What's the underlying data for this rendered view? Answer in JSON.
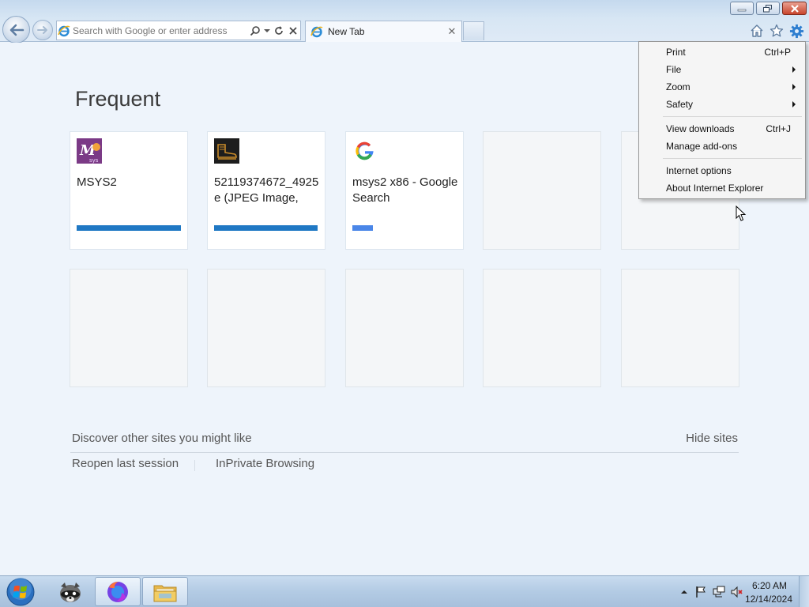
{
  "window": {
    "minimize_icon": "minimize-icon",
    "restore_icon": "restore-icon",
    "close_icon": "close-icon"
  },
  "navigation": {
    "back_icon": "back-arrow-icon",
    "forward_icon": "forward-arrow-icon"
  },
  "address_bar": {
    "placeholder": "Search with Google or enter address",
    "icons": [
      "ie-logo-icon",
      "search-icon",
      "dropdown-arrow-icon",
      "refresh-icon",
      "stop-icon"
    ]
  },
  "tabs": [
    {
      "label": "New Tab",
      "icon": "ie-logo-icon",
      "active": true
    }
  ],
  "toolbar": {
    "icons": [
      "home-icon",
      "favorites-star-icon",
      "tools-gear-icon"
    ]
  },
  "new_tab_page": {
    "title": "Frequent",
    "tiles": [
      {
        "title": "MSYS2",
        "icon": "msys2-logo-icon",
        "bar_fraction": 1.0
      },
      {
        "title": "52119374672_4925e (JPEG Image,",
        "icon": "boot-image-icon",
        "bar_fraction": 1.0
      },
      {
        "title": "msys2 x86 - Google Search",
        "icon": "google-g-icon",
        "bar_fraction": 0.2
      }
    ],
    "discover_text": "Discover other sites you might like",
    "hide_sites_label": "Hide sites",
    "reopen_label": "Reopen last session",
    "inprivate_label": "InPrivate Browsing"
  },
  "tools_menu": {
    "items": [
      {
        "label": "Print",
        "shortcut": "Ctrl+P",
        "submenu": false
      },
      {
        "label": "File",
        "shortcut": "",
        "submenu": true
      },
      {
        "label": "Zoom",
        "shortcut": "",
        "submenu": true
      },
      {
        "label": "Safety",
        "shortcut": "",
        "submenu": true
      },
      {
        "label": "View downloads",
        "shortcut": "Ctrl+J",
        "submenu": false
      },
      {
        "label": "Manage add-ons",
        "shortcut": "",
        "submenu": false
      },
      {
        "label": "Internet options",
        "shortcut": "",
        "submenu": false
      },
      {
        "label": "About Internet Explorer",
        "shortcut": "",
        "submenu": false
      }
    ]
  },
  "taskbar": {
    "start_icon": "windows-start-icon",
    "apps": [
      {
        "name": "raccoon-app-icon",
        "active": false
      },
      {
        "name": "firefox-icon",
        "active": true
      },
      {
        "name": "file-explorer-icon",
        "active": true
      }
    ],
    "tray_icons": [
      "show-hidden-icons-arrow",
      "action-center-flag-icon",
      "network-icon",
      "volume-muted-icon"
    ],
    "clock_time": "6:20 AM",
    "clock_date": "12/14/2024"
  },
  "colors": {
    "page_background": "#eef4fb",
    "tile_bar_blue": "#1f78c4",
    "google_bar_blue": "#4a86e8",
    "msys2_purple": "#7b3a86"
  }
}
